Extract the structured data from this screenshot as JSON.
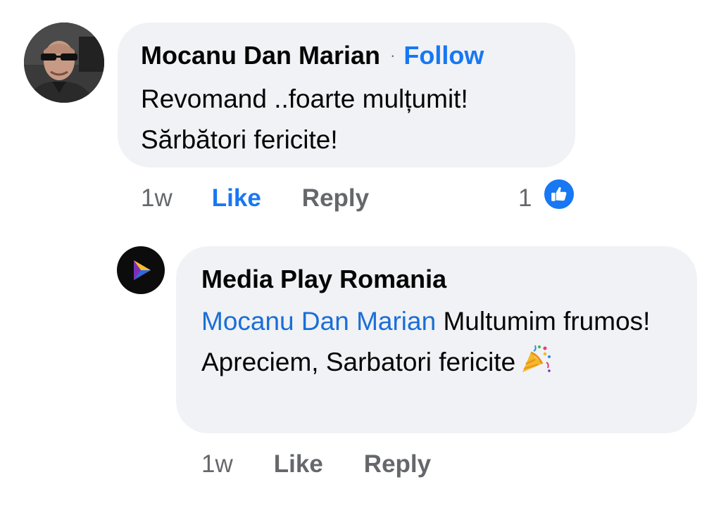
{
  "comment": {
    "author": "Mocanu Dan Marian",
    "separator": "·",
    "follow_label": "Follow",
    "text_line1": "Revomand ..foarte mulțumit!",
    "text_line2": "Sărbători fericite!",
    "time": "1w",
    "like_label": "Like",
    "reply_label": "Reply",
    "reaction_count": "1",
    "reaction_icon": "thumbs-up-icon",
    "like_color": "#1877f2"
  },
  "reply": {
    "author": "Media Play Romania",
    "mention": "Mocanu Dan Marian",
    "text": " Multumim frumos! Apreciem, Sarbatori fericite",
    "emoji_icon": "party-popper-icon",
    "time": "1w",
    "like_label": "Like",
    "reply_label": "Reply"
  },
  "colors": {
    "bubble": "#f0f2f5",
    "link_blue": "#1877f2",
    "secondary_text": "#65676b"
  }
}
